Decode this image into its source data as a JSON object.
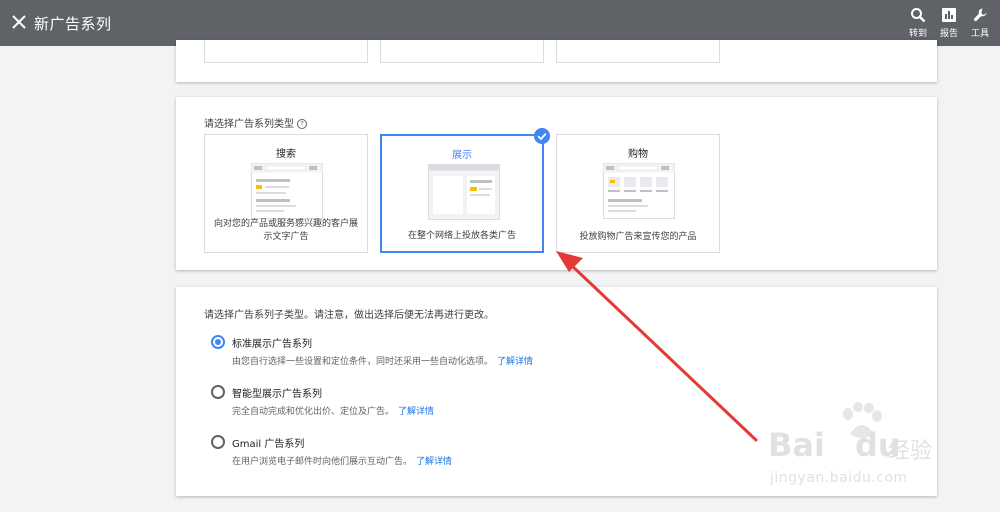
{
  "header": {
    "title": "新广告系列",
    "close_icon": "close-icon",
    "actions": [
      {
        "label": "转到",
        "icon": "search-icon"
      },
      {
        "label": "报告",
        "icon": "bar-chart-icon"
      },
      {
        "label": "工具",
        "icon": "wrench-icon"
      }
    ]
  },
  "campaign_type": {
    "label": "请选择广告系列类型",
    "options": [
      {
        "name": "搜索",
        "desc": "向对您的产品或服务感兴趣的客户展示文字广告",
        "selected": false
      },
      {
        "name": "展示",
        "desc": "在整个网络上投放各类广告",
        "selected": true
      },
      {
        "name": "购物",
        "desc": "投放购物广告来宣传您的产品",
        "selected": false
      }
    ]
  },
  "subtype": {
    "label": "请选择广告系列子类型。请注意，做出选择后便无法再进行更改。",
    "link_text": "了解详情",
    "options": [
      {
        "name": "标准展示广告系列",
        "desc": "由您自行选择一些设置和定位条件，同时还采用一些自动化选项。",
        "selected": true
      },
      {
        "name": "智能型展示广告系列",
        "desc": "完全自动完成和优化出价、定位及广告。",
        "selected": false
      },
      {
        "name": "Gmail 广告系列",
        "desc": "在用户浏览电子邮件时向他们展示互动广告。",
        "selected": false
      }
    ]
  },
  "watermark": {
    "brand_latin_1": "Bai",
    "brand_latin_2": "du",
    "brand_cn": "经验",
    "url": "jingyan.baidu.com"
  },
  "colors": {
    "topbar": "#5f6368",
    "accent": "#4285f4",
    "link": "#1a73e8",
    "arrow": "#e53935",
    "thumb_yellow": "#fbbc04"
  }
}
